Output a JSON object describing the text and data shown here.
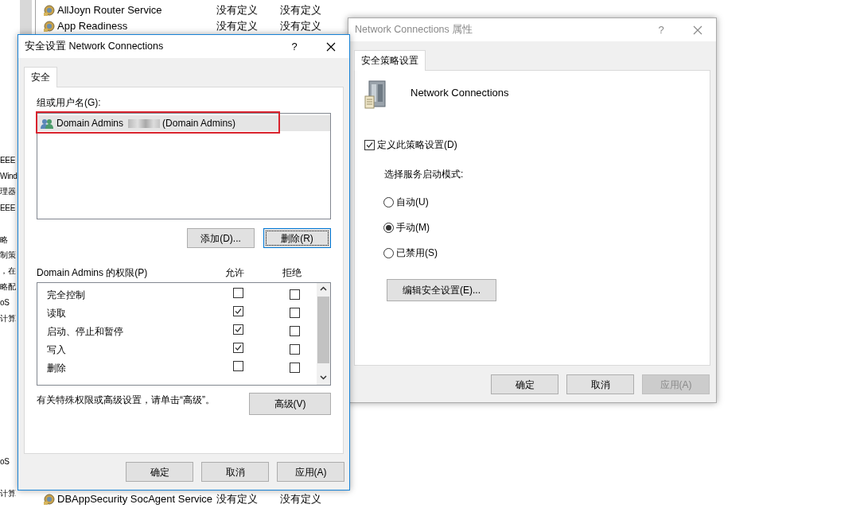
{
  "background": {
    "left_fragments": [
      {
        "text": "EEE"
      },
      {
        "text": "Wind"
      },
      {
        "text": "理器"
      },
      {
        "text": "EEE"
      },
      {
        "text": "略"
      },
      {
        "text": "制策"
      },
      {
        "text": "，在"
      },
      {
        "text": "略配"
      },
      {
        "text": "oS"
      },
      {
        "text": "计算"
      },
      {
        "text": "oS"
      },
      {
        "text": "计算"
      }
    ],
    "services": [
      {
        "name": "AllJoyn Router Service",
        "column_2": "没有定义",
        "column_3": "没有定义"
      },
      {
        "name": "App Readiness",
        "column_2": "没有定义",
        "column_3": "没有定义"
      },
      {
        "name": "DBAppSecurity SocAgent Service",
        "column_2": "没有定义",
        "column_3": "没有定义"
      }
    ]
  },
  "security_dialog": {
    "title": "安全设置 Network Connections",
    "help": "?",
    "tabs": [
      {
        "label": "安全",
        "selected": true
      }
    ],
    "group_label": "组或用户名(G):",
    "principals": [
      {
        "name": "Domain Admins",
        "account": "(Domain Admins)",
        "selected": true,
        "annotated": true
      }
    ],
    "principal_buttons": [
      {
        "label": "添加(D)...",
        "focused": false
      },
      {
        "label": "删除(R)",
        "focused": true
      }
    ],
    "permissions_label": "Domain Admins 的权限(P)",
    "allow_header": "允许",
    "deny_header": "拒绝",
    "permissions": [
      {
        "name": "完全控制",
        "allow": false,
        "deny": false
      },
      {
        "name": "读取",
        "allow": true,
        "deny": false
      },
      {
        "name": "启动、停止和暂停",
        "allow": true,
        "deny": false
      },
      {
        "name": "写入",
        "allow": true,
        "deny": false
      },
      {
        "name": "删除",
        "allow": false,
        "deny": false
      }
    ],
    "advanced_note": "有关特殊权限或高级设置，请单击“高级”。",
    "advanced_button": "高级(V)",
    "footer_buttons": [
      {
        "label": "确定",
        "disabled": false
      },
      {
        "label": "取消",
        "disabled": false
      },
      {
        "label": "应用(A)",
        "disabled": false
      }
    ]
  },
  "properties_dialog": {
    "title": "Network Connections 属性",
    "help": "?",
    "tabs": [
      {
        "label": "安全策略设置",
        "selected": true
      }
    ],
    "service_name": "Network Connections",
    "define_policy": {
      "label": "定义此策略设置(D)",
      "checked": true
    },
    "startup_label": "选择服务启动模式:",
    "startup_modes": [
      {
        "label": "自动(U)",
        "selected": false
      },
      {
        "label": "手动(M)",
        "selected": true
      },
      {
        "label": "已禁用(S)",
        "selected": false
      }
    ],
    "edit_button": "编辑安全设置(E)...",
    "footer_buttons": [
      {
        "label": "确定",
        "disabled": false
      },
      {
        "label": "取消",
        "disabled": false
      },
      {
        "label": "应用(A)",
        "disabled": true
      }
    ]
  }
}
